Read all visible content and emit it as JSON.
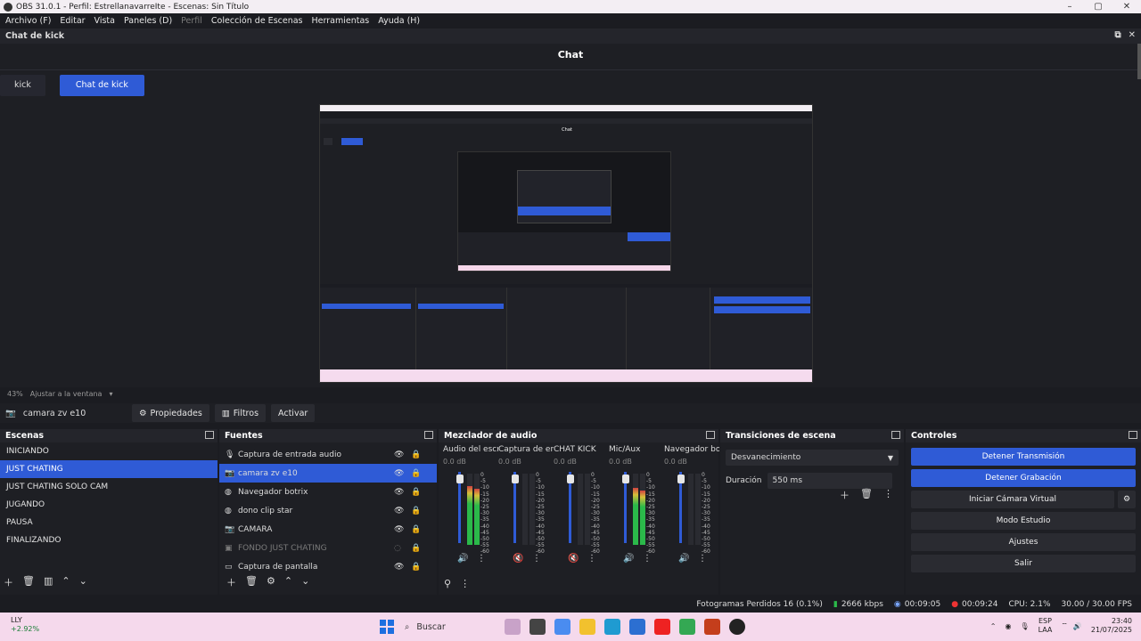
{
  "window": {
    "title": "OBS 31.0.1 - Perfil: EstrellanavarreIte - Escenas: Sin Título",
    "controls": [
      "–",
      "▢",
      "✕"
    ]
  },
  "menu": [
    {
      "label": "Archivo (F)",
      "dim": false
    },
    {
      "label": "Editar",
      "dim": false
    },
    {
      "label": "Vista",
      "dim": false
    },
    {
      "label": "Paneles (D)",
      "dim": false
    },
    {
      "label": "Perfil",
      "dim": true
    },
    {
      "label": "Colección de Escenas",
      "dim": false
    },
    {
      "label": "Herramientas",
      "dim": false
    },
    {
      "label": "Ayuda (H)",
      "dim": false
    }
  ],
  "chat_dock": {
    "header": "Chat de kick",
    "title": "Chat",
    "tabs": [
      {
        "label": "kick",
        "active": false
      },
      {
        "label": "Chat de kick",
        "active": true
      }
    ]
  },
  "preview_footer": {
    "zoom": "43%",
    "fit_label": "Ajustar a la ventana"
  },
  "source_toolbar": {
    "source_name": "camara zv e10",
    "properties": "Propiedades",
    "filters": "Filtros",
    "activate": "Activar"
  },
  "scenes": {
    "header": "Escenas",
    "items": [
      "INICIANDO",
      "JUST CHATING",
      "JUST CHATING SOLO CAM",
      "JUGANDO",
      "PAUSA",
      "FINALIZANDO"
    ],
    "selected_index": 1
  },
  "sources": {
    "header": "Fuentes",
    "items": [
      {
        "name": "Captura de entrada audio",
        "icon": "mic-icon",
        "glyph": "🎙",
        "visible": true,
        "selected": false
      },
      {
        "name": "camara zv e10",
        "icon": "camera-icon",
        "glyph": "📷",
        "visible": true,
        "selected": true
      },
      {
        "name": "Navegador botrix",
        "icon": "globe-icon",
        "glyph": "◍",
        "visible": true,
        "selected": false
      },
      {
        "name": "dono clip star",
        "icon": "globe-icon",
        "glyph": "◍",
        "visible": true,
        "selected": false
      },
      {
        "name": "CAMARA",
        "icon": "camera-icon",
        "glyph": "📷",
        "visible": true,
        "selected": false
      },
      {
        "name": "FONDO JUST CHATING",
        "icon": "image-icon",
        "glyph": "▣",
        "visible": false,
        "selected": false
      },
      {
        "name": "Captura de pantalla",
        "icon": "monitor-icon",
        "glyph": "▭",
        "visible": true,
        "selected": false
      }
    ]
  },
  "mixer": {
    "header": "Mezclador de audio",
    "scale": [
      "0",
      "-5",
      "-10",
      "-15",
      "-20",
      "-25",
      "-30",
      "-35",
      "-40",
      "-45",
      "-50",
      "-55",
      "-60"
    ],
    "channels": [
      {
        "name": "Audio del escrito",
        "db": "0.0 dB",
        "level": 0.82,
        "fader": 0.92,
        "muted": false
      },
      {
        "name": "Captura de entra",
        "db": "0.0 dB",
        "level": 0.0,
        "fader": 0.92,
        "muted": true
      },
      {
        "name": "CHAT KICK",
        "db": "0.0 dB",
        "level": 0.0,
        "fader": 0.92,
        "muted": true
      },
      {
        "name": "Mic/Aux",
        "db": "0.0 dB",
        "level": 0.8,
        "fader": 0.92,
        "muted": false
      },
      {
        "name": "Navegador bo",
        "db": "0.0 dB",
        "level": 0.0,
        "fader": 0.92,
        "muted": false
      }
    ]
  },
  "transitions": {
    "header": "Transiciones de escena",
    "type": "Desvanecimiento",
    "duration_label": "Duración",
    "duration_value": "550 ms"
  },
  "controls": {
    "header": "Controles",
    "stop_stream": "Detener Transmisión",
    "stop_record": "Detener Grabación",
    "virtual_cam": "Iniciar Cámara Virtual",
    "studio_mode": "Modo Estudio",
    "settings": "Ajustes",
    "exit": "Salir"
  },
  "status": {
    "dropped": "Fotogramas Perdidos 16 (0.1%)",
    "bitrate": "2666 kbps",
    "stream_time": "00:09:05",
    "rec_time": "00:09:24",
    "cpu": "CPU: 2.1%",
    "fps": "30.00 / 30.00 FPS"
  },
  "taskbar": {
    "ticker": "LLY",
    "ticker_change": "+2.92%",
    "search": "Buscar",
    "lang": "ESP",
    "region": "LAA",
    "time": "23:40",
    "date": "21/07/2025"
  },
  "colors": {
    "accent": "#2f5bd6",
    "bg": "#1e1f24",
    "header": "#24252b"
  }
}
